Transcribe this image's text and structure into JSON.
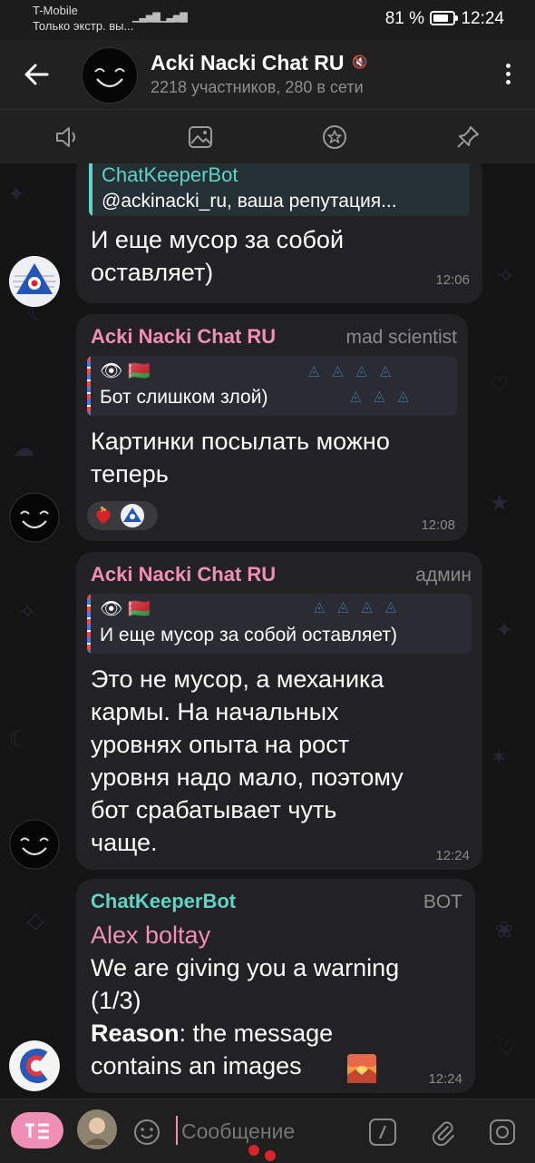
{
  "statusbar": {
    "carrier": "T-Mobile",
    "carrier_sub": "Только экстр. вы...",
    "battery": "81 %",
    "time": "12:24"
  },
  "header": {
    "title": "Acki Nacki Chat RU",
    "subtitle": "2218 участников, 280 в сети",
    "muted_icon": "speaker-muted-icon"
  },
  "toolbar": {
    "icons": [
      "audio-icon",
      "image-icon",
      "star-icon",
      "pin-icon"
    ]
  },
  "messages": [
    {
      "reply_sender": "ChatKeeperBot",
      "reply_text": "@ackinacki_ru, ваша репутация...",
      "text_l1": "И еще мусор за собой",
      "text_l2": "оставляет)",
      "time": "12:06"
    },
    {
      "sender": "Acki Nacki Chat RU",
      "role": "mad scientist",
      "reply_emoji": "👁 🇧🇾",
      "reply_text": "Бот слишком злой)",
      "text_l1": "Картинки посылать можно",
      "text_l2": "теперь",
      "time": "12:08"
    },
    {
      "sender": "Acki Nacki Chat RU",
      "role": "админ",
      "reply_emoji": "👁 🇧🇾",
      "reply_text": "И еще мусор за собой оставляет)",
      "lines": [
        "Это не мусор, а механика",
        "кармы. На начальных",
        "уровнях опыта на рост",
        "уровня надо мало, поэтому",
        "бот срабатывает чуть",
        "чаще."
      ],
      "time": "12:24"
    },
    {
      "sender": "ChatKeeperBot",
      "role": "BOT",
      "mention": "Alex boltay",
      "lines": [
        "We are giving you a warning",
        "(1/3)"
      ],
      "reason_label": "Reason",
      "reason_text_l1": ": the message",
      "reason_text_l2": "contains an images",
      "time": "12:24"
    }
  ],
  "input": {
    "placeholder": "Сообщение"
  },
  "colors": {
    "accent_pink": "#ef8fb6",
    "accent_teal": "#5fd3c6",
    "bubble": "#222123"
  }
}
